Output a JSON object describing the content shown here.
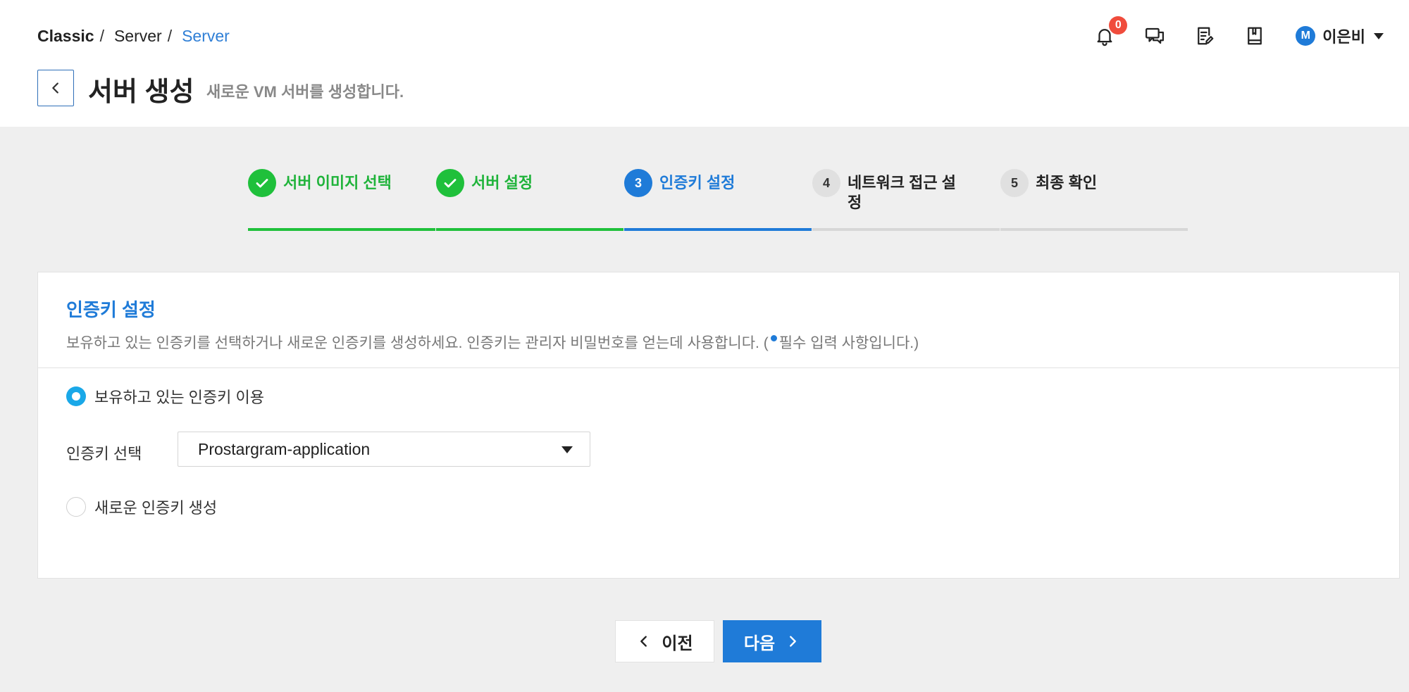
{
  "breadcrumb": {
    "root": "Classic",
    "level1": "Server",
    "current": "Server",
    "separator": "/"
  },
  "header": {
    "notification_count": "0",
    "icons": [
      "bell-icon",
      "chat-icon",
      "notepad-icon",
      "book-icon"
    ],
    "user": {
      "avatar_initial": "M",
      "name": "이은비"
    }
  },
  "page": {
    "title": "서버 생성",
    "subtitle": "새로운 VM 서버를 생성합니다."
  },
  "steps": [
    {
      "number": "1",
      "label": "서버 이미지 선택",
      "status": "done"
    },
    {
      "number": "2",
      "label": "서버 설정",
      "status": "done"
    },
    {
      "number": "3",
      "label": "인증키 설정",
      "status": "active"
    },
    {
      "number": "4",
      "label": "네트워크 접근 설정",
      "status": "todo"
    },
    {
      "number": "5",
      "label": "최종 확인",
      "status": "todo"
    }
  ],
  "card": {
    "title": "인증키 설정",
    "description": "보유하고 있는 인증키를 선택하거나 새로운 인증키를 생성하세요. 인증키는 관리자 비밀번호를 얻는데 사용합니다. (",
    "required_note": "필수 입력 사항입니다.)",
    "option_existing": "보유하고 있는 인증키 이용",
    "option_new": "새로운 인증키 생성",
    "select_label": "인증키 선택",
    "selected_key": "Prostargram-application"
  },
  "footer": {
    "prev_label": "이전",
    "next_label": "다음"
  },
  "colors": {
    "primary": "#1f7bd8",
    "success": "#1fc03b",
    "radio": "#1aa8e8",
    "badge": "#f04c3c",
    "background": "#efefef"
  }
}
